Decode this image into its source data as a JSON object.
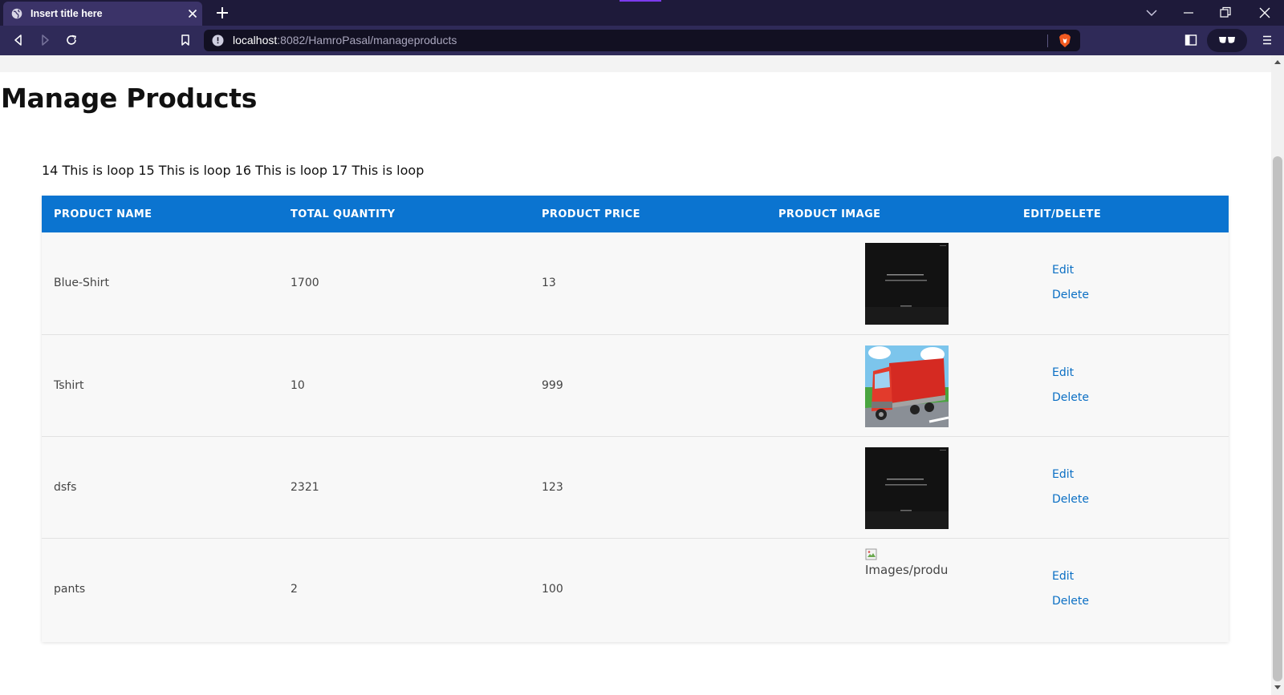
{
  "browser": {
    "tab_title": "Insert title here",
    "url_host": "localhost",
    "url_rest": ":8082/HamroPasal/manageproducts"
  },
  "page": {
    "title": "Manage Products",
    "loop_text": "14 This is loop 15 This is loop 16 This is loop 17 This is loop"
  },
  "table": {
    "headers": [
      "PRODUCT NAME",
      "TOTAL QUANTITY",
      "PRODUCT PRICE",
      "PRODUCT IMAGE",
      "EDIT/DELETE"
    ],
    "rows": [
      {
        "name": "Blue-Shirt",
        "quantity": "1700",
        "price": "13",
        "image": "dark-screenshot",
        "edit": "Edit",
        "delete": "Delete"
      },
      {
        "name": "Tshirt",
        "quantity": "10",
        "price": "999",
        "image": "red-truck",
        "edit": "Edit",
        "delete": "Delete"
      },
      {
        "name": "dsfs",
        "quantity": "2321",
        "price": "123",
        "image": "dark-screenshot",
        "edit": "Edit",
        "delete": "Delete"
      },
      {
        "name": "pants",
        "quantity": "2",
        "price": "100",
        "image": "broken",
        "image_alt": "Images/produ",
        "edit": "Edit",
        "delete": "Delete"
      }
    ]
  },
  "colors": {
    "header_bg": "#0b74d0",
    "link": "#0b6fc4",
    "chrome_tabbar": "#1e1a3a",
    "chrome_toolbar": "#2f2a58"
  }
}
